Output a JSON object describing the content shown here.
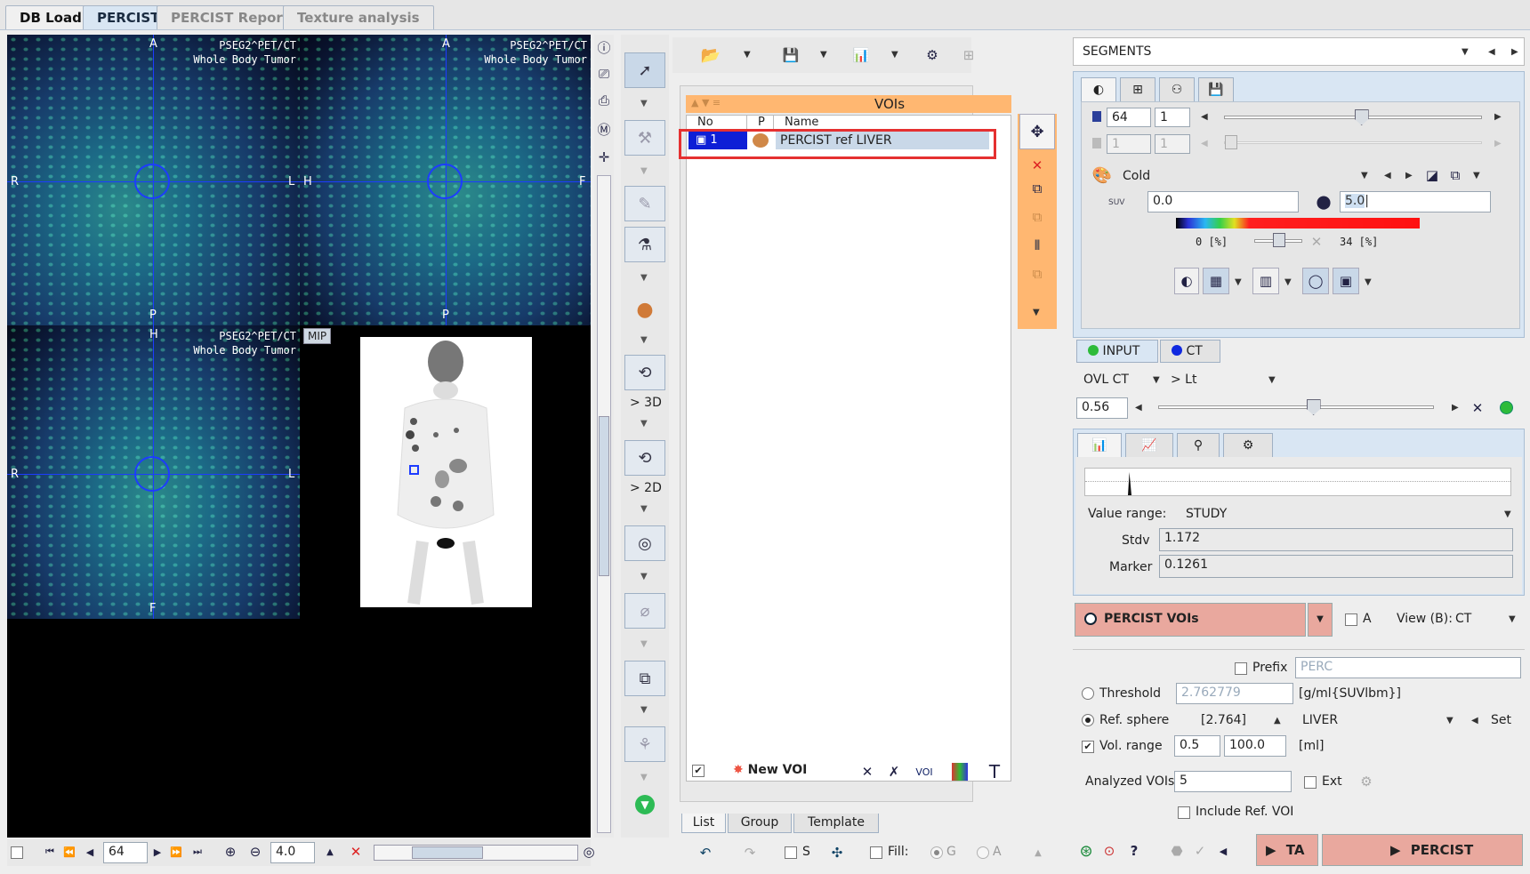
{
  "tabs": [
    "DB Load",
    "PERCIST",
    "PERCIST Report",
    "Texture analysis"
  ],
  "viewports": {
    "study_line1": "PSEG2^PET/CT",
    "study_line2": "Whole Body Tumor",
    "axial": {
      "top": "A",
      "bottom": "P",
      "left": "R",
      "right": "L"
    },
    "sagittal": {
      "top": "A",
      "bottom": "P",
      "left": "H",
      "right": "F"
    },
    "coronal": {
      "top": "H",
      "bottom": "F",
      "left": "R",
      "right": "L"
    },
    "mip_label": "MIP"
  },
  "bottom_bar": {
    "slice": "64",
    "zoom": "4.0"
  },
  "tools": {
    "to3d": "> 3D",
    "to2d": "> 2D"
  },
  "voi_panel": {
    "header": "VOIs",
    "columns": [
      "No",
      "P",
      "Name"
    ],
    "rows": [
      {
        "no": "1",
        "name": "PERCIST ref LIVER"
      }
    ],
    "new_voi": "New VOI",
    "tabs": [
      "List",
      "Group",
      "Template"
    ]
  },
  "lower_toolbar": {
    "s_label": "S",
    "fill_label": "Fill:",
    "g_label": "G",
    "a_label": "A"
  },
  "segments": {
    "title": "SEGMENTS",
    "slice_val": "64",
    "slice_step": "1",
    "slice2_val": "1",
    "slice2_step": "1",
    "slice_fraction": 0.53,
    "colormap": "Cold",
    "unit": "SUV",
    "min": "0.0",
    "max": "5.0",
    "pct_min": "0 [%]",
    "pct_max": "34 [%]",
    "input_tab": "INPUT",
    "ct_tab": "CT",
    "ovl": "OVL CT",
    "ovl_mode": "> Lt",
    "ovl_val": "0.56",
    "ovl_fraction": 0.56,
    "value_range_label": "Value range:",
    "value_range": "STUDY",
    "stdv_label": "Stdv",
    "stdv": "1.172",
    "marker_label": "Marker",
    "marker": "0.1261"
  },
  "percist": {
    "vois_label": "PERCIST VOIs",
    "a_label": "A",
    "view_label": "View (B):",
    "view_val": "CT",
    "prefix_label": "Prefix",
    "prefix": "PERC",
    "threshold_label": "Threshold",
    "threshold": "2.762779",
    "threshold_unit": "[g/ml{SUVlbm}]",
    "ref_label": "Ref. sphere",
    "ref_val": "[2.764]",
    "ref_organ": "LIVER",
    "set_label": "Set",
    "vol_label": "Vol. range",
    "vol_min": "0.5",
    "vol_max": "100.0",
    "vol_unit": "[ml]",
    "analyzed_label": "Analyzed VOIs",
    "analyzed": "5",
    "ext_label": "Ext",
    "include_label": "Include Ref. VOI",
    "ta_btn": "TA",
    "percist_btn": "PERCIST"
  },
  "colors": {
    "accent": "#ffb771",
    "highlight": "#e53030",
    "voi_blue": "#1d3cff",
    "red_button": "#e9a89e"
  }
}
